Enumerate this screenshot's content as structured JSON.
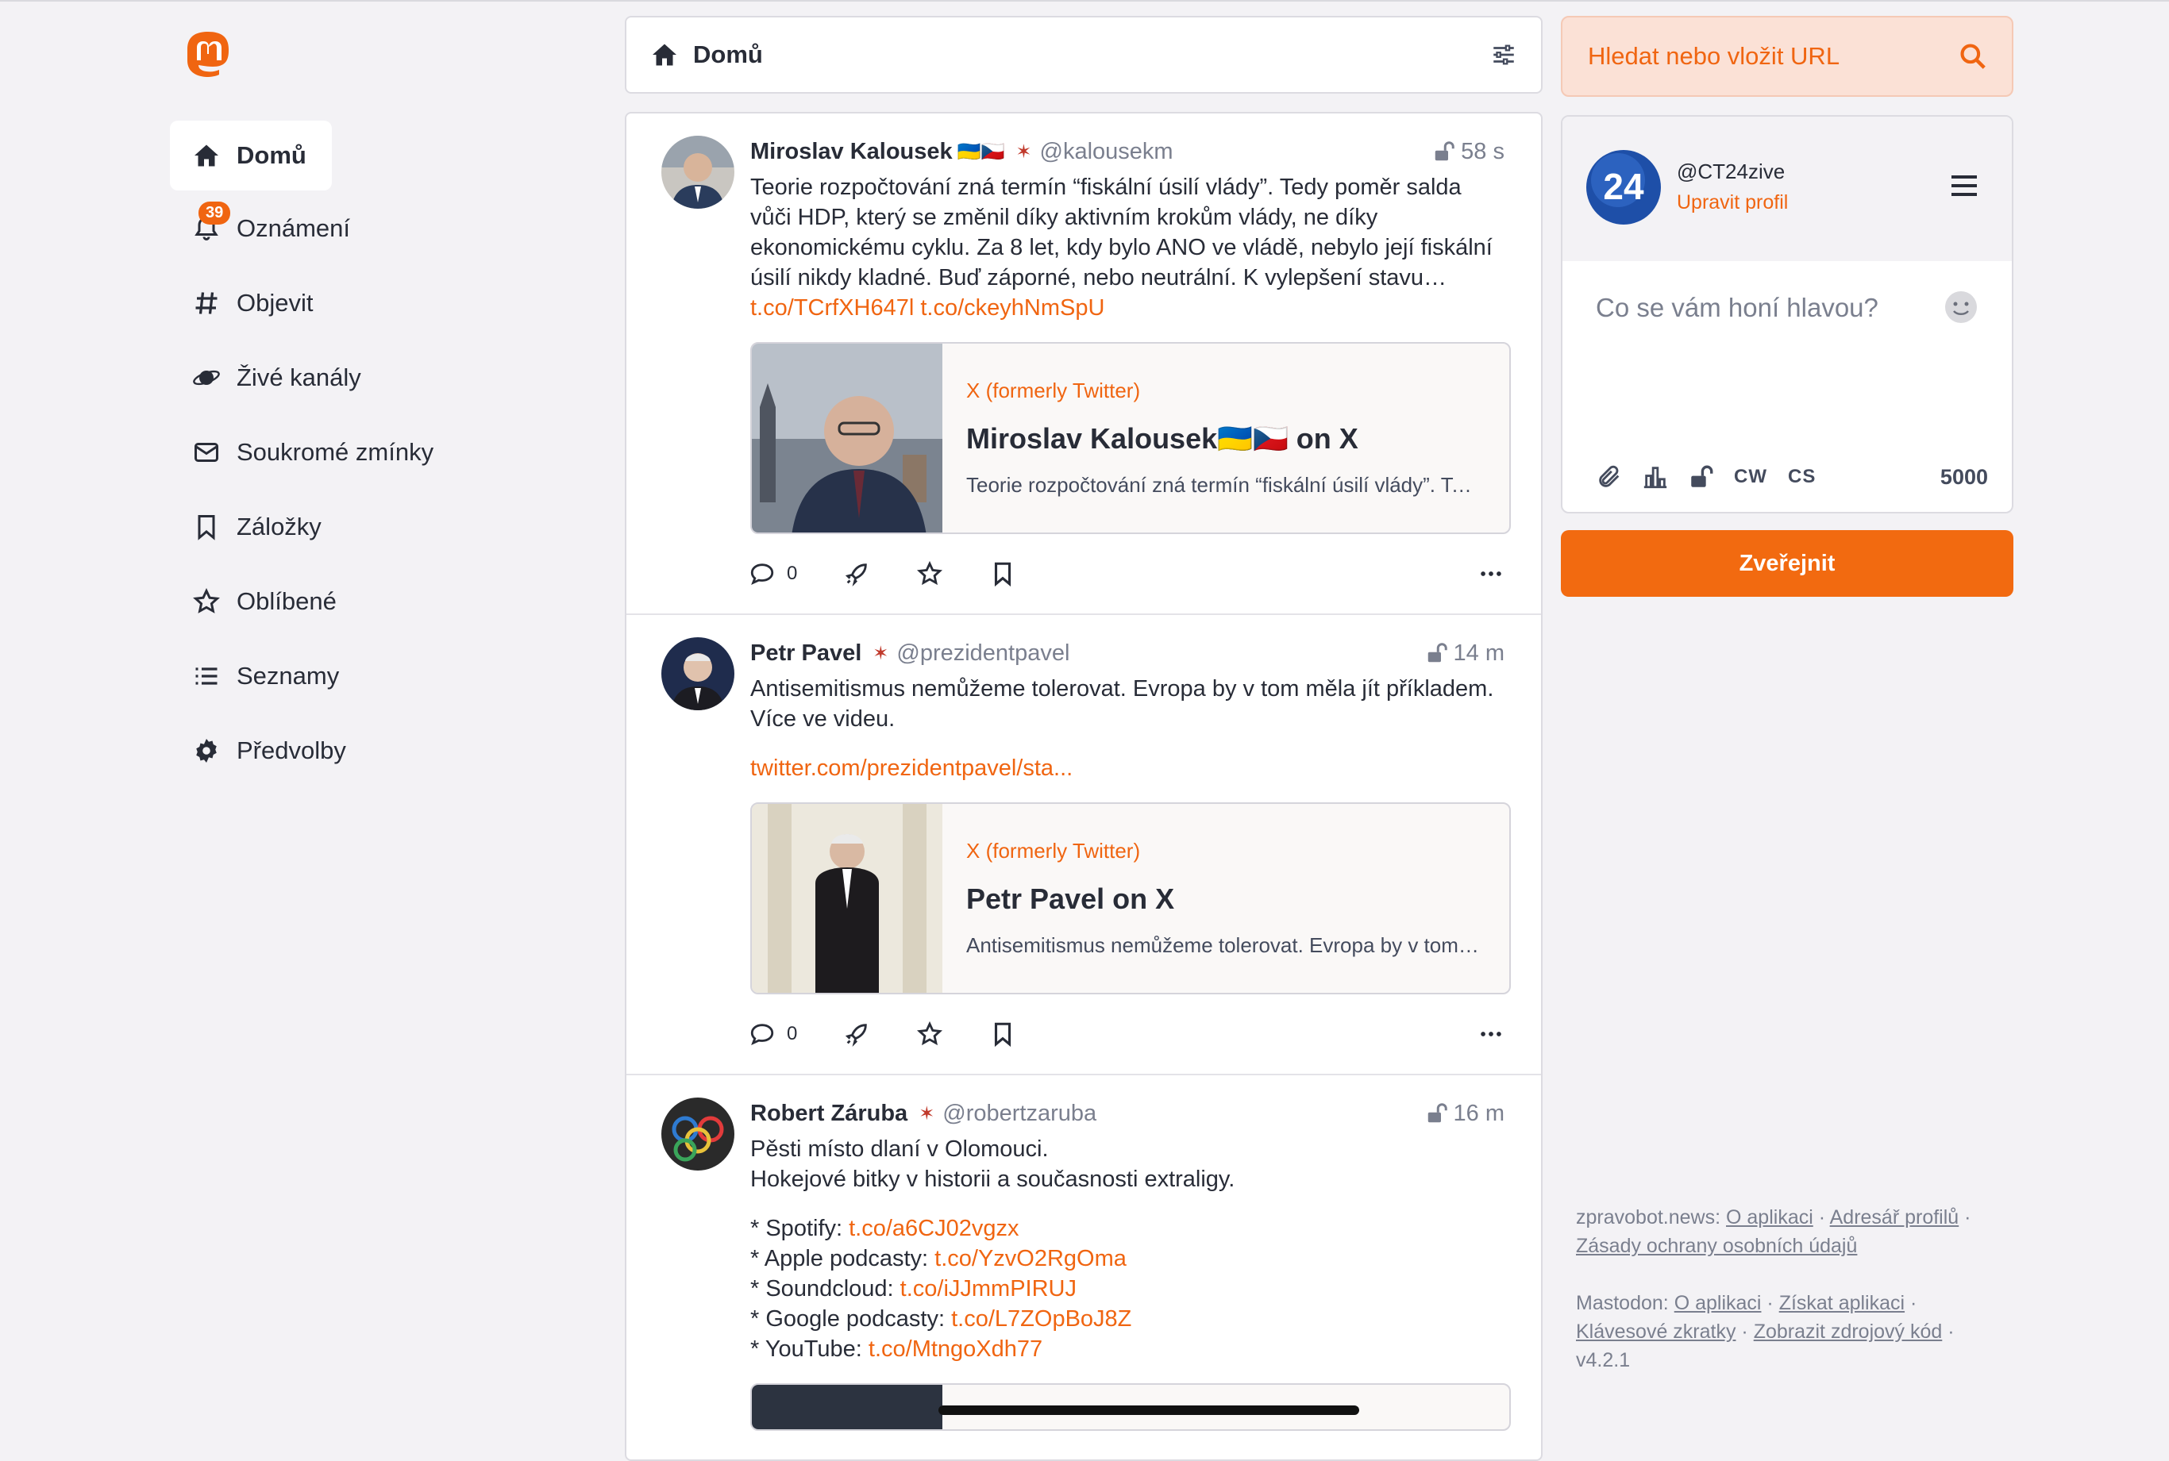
{
  "nav": {
    "items": [
      {
        "label": "Domů",
        "icon": "home-icon",
        "active": true
      },
      {
        "label": "Oznámení",
        "icon": "bell-icon",
        "badge": "39"
      },
      {
        "label": "Objevit",
        "icon": "hashtag-icon"
      },
      {
        "label": "Živé kanály",
        "icon": "planet-icon"
      },
      {
        "label": "Soukromé zmínky",
        "icon": "envelope-icon"
      },
      {
        "label": "Záložky",
        "icon": "bookmark-icon"
      },
      {
        "label": "Oblíbené",
        "icon": "star-icon"
      },
      {
        "label": "Seznamy",
        "icon": "list-icon"
      },
      {
        "label": "Předvolby",
        "icon": "gear-icon"
      }
    ]
  },
  "header": {
    "title": "Domů"
  },
  "search": {
    "placeholder": "Hledat nebo vložit URL"
  },
  "account": {
    "handle": "@CT24zive",
    "edit_label": "Upravit profil",
    "avatar_text": "24"
  },
  "compose": {
    "placeholder": "Co se vám honí hlavou?",
    "cw": "CW",
    "lang": "CS",
    "char_count": "5000",
    "publish_label": "Zveřejnit"
  },
  "posts": [
    {
      "name": "Miroslav Kalousek",
      "flags": "🇺🇦🇨🇿",
      "acct": "@kalousekm",
      "time": "58 s",
      "text": "Teorie rozpočtování zná termín “fiskální úsilí vlády”. Tedy poměr salda vůči HDP, který se změnil díky aktivním krokům vlády, ne díky ekonomickému cyklu. Za 8 let, kdy bylo ANO ve vládě, nebylo její fiskální úsilí nikdy kladné. Buď záporné, nebo neutrální. K vylepšení stavu…",
      "links": [
        "t.co/TCrfXH647l",
        "t.co/ckeyhNmSpU"
      ],
      "card": {
        "provider": "X (formerly Twitter)",
        "title": "Miroslav Kalousek🇺🇦🇨🇿 on X",
        "description": "Teorie rozpočtování zná termín “fiskální úsilí vlády”. Tedy poměr salda vůči HDP"
      },
      "replies": "0"
    },
    {
      "name": "Petr Pavel",
      "acct": "@prezidentpavel",
      "time": "14 m",
      "text": "Antisemitismus nemůžeme tolerovat. Evropa by v tom měla jít příkladem. Více ve videu.",
      "link": "twitter.com/prezidentpavel/sta...",
      "card": {
        "provider": "X (formerly Twitter)",
        "title": "Petr Pavel on X",
        "description": "Antisemitismus nemůžeme tolerovat. Evropa by v tom měla jít příkladem."
      },
      "replies": "0"
    },
    {
      "name": "Robert Záruba",
      "acct": "@robertzaruba",
      "time": "16 m",
      "text1": "Pěsti místo dlaní v Olomouci.",
      "text2": "Hokejové bitky v historii a současnosti extraligy.",
      "lines": [
        {
          "label": "* Spotify: ",
          "link": "t.co/a6CJ02vgzx"
        },
        {
          "label": "* Apple podcasty: ",
          "link": "t.co/YzvO2RgOma"
        },
        {
          "label": "* Soundcloud: ",
          "link": "t.co/iJJmmPIRUJ"
        },
        {
          "label": "* Google podcasty: ",
          "link": "t.co/L7ZOpBoJ8Z"
        },
        {
          "label": "* YouTube: ",
          "link": "t.co/MtngoXdh77"
        }
      ]
    }
  ],
  "footer": {
    "site": "zpravobot.news",
    "site_links": [
      "O aplikaci",
      "Adresář profilů",
      "Zásady ochrany osobních údajů"
    ],
    "mastodon": "Mastodon",
    "mastodon_links": [
      "O aplikaci",
      "Získat aplikaci",
      "Klávesové zkratky",
      "Zobrazit zdrojový kód"
    ],
    "version": "v4.2.1"
  },
  "colors": {
    "accent": "#f06511",
    "background": "#f3f2f5",
    "text": "#282c37"
  }
}
